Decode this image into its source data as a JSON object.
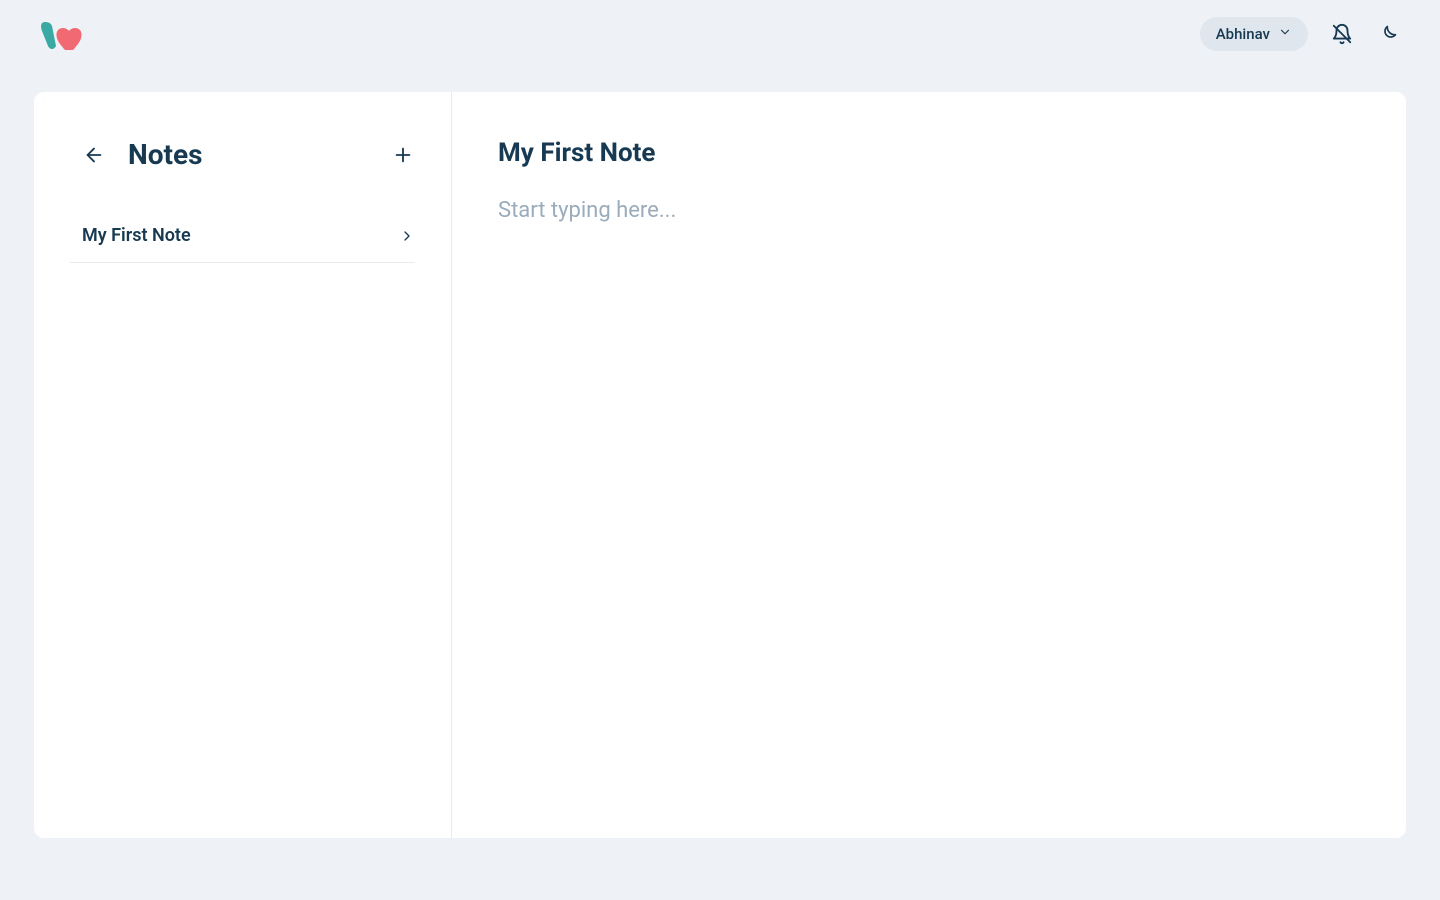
{
  "header": {
    "user_name": "Abhinav"
  },
  "sidebar": {
    "title": "Notes",
    "items": [
      {
        "label": "My First Note"
      }
    ]
  },
  "editor": {
    "title": "My First Note",
    "body_placeholder": "Start typing here..."
  }
}
